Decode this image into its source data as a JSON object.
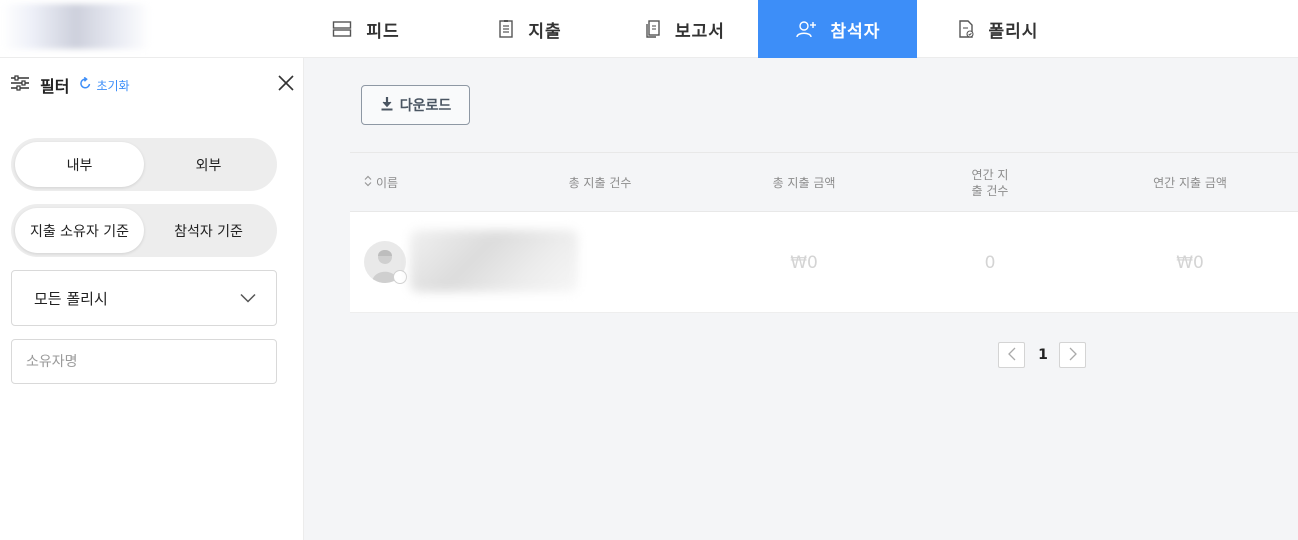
{
  "nav": {
    "tabs": [
      {
        "label": "피드",
        "icon": "feed-icon"
      },
      {
        "label": "지출",
        "icon": "receipt-icon"
      },
      {
        "label": "보고서",
        "icon": "report-icon"
      },
      {
        "label": "참석자",
        "icon": "add-user-icon",
        "active": true
      },
      {
        "label": "폴리시",
        "icon": "policy-icon"
      }
    ]
  },
  "sidebar": {
    "title": "필터",
    "reset_label": "초기화",
    "segment_scope": {
      "options": [
        "내부",
        "외부"
      ],
      "selected": "내부"
    },
    "segment_basis": {
      "options": [
        "지출 소유자 기준",
        "참석자 기준"
      ],
      "selected": "지출 소유자 기준"
    },
    "policy_select": {
      "value": "모든 폴리시"
    },
    "owner_input": {
      "placeholder": "소유자명",
      "value": ""
    }
  },
  "main": {
    "download_label": "다운로드",
    "table": {
      "columns": [
        "이름",
        "총 지출 건수",
        "총 지출 금액",
        "연간 지\n출 건수",
        "연간 지출 금액"
      ],
      "rows": [
        {
          "total_amount": "₩0",
          "annual_count": "0",
          "annual_amount": "₩0"
        }
      ]
    },
    "pagination": {
      "current_page": "1"
    }
  },
  "colors": {
    "accent": "#3d8ef8",
    "main_bg": "#f4f5f7"
  }
}
